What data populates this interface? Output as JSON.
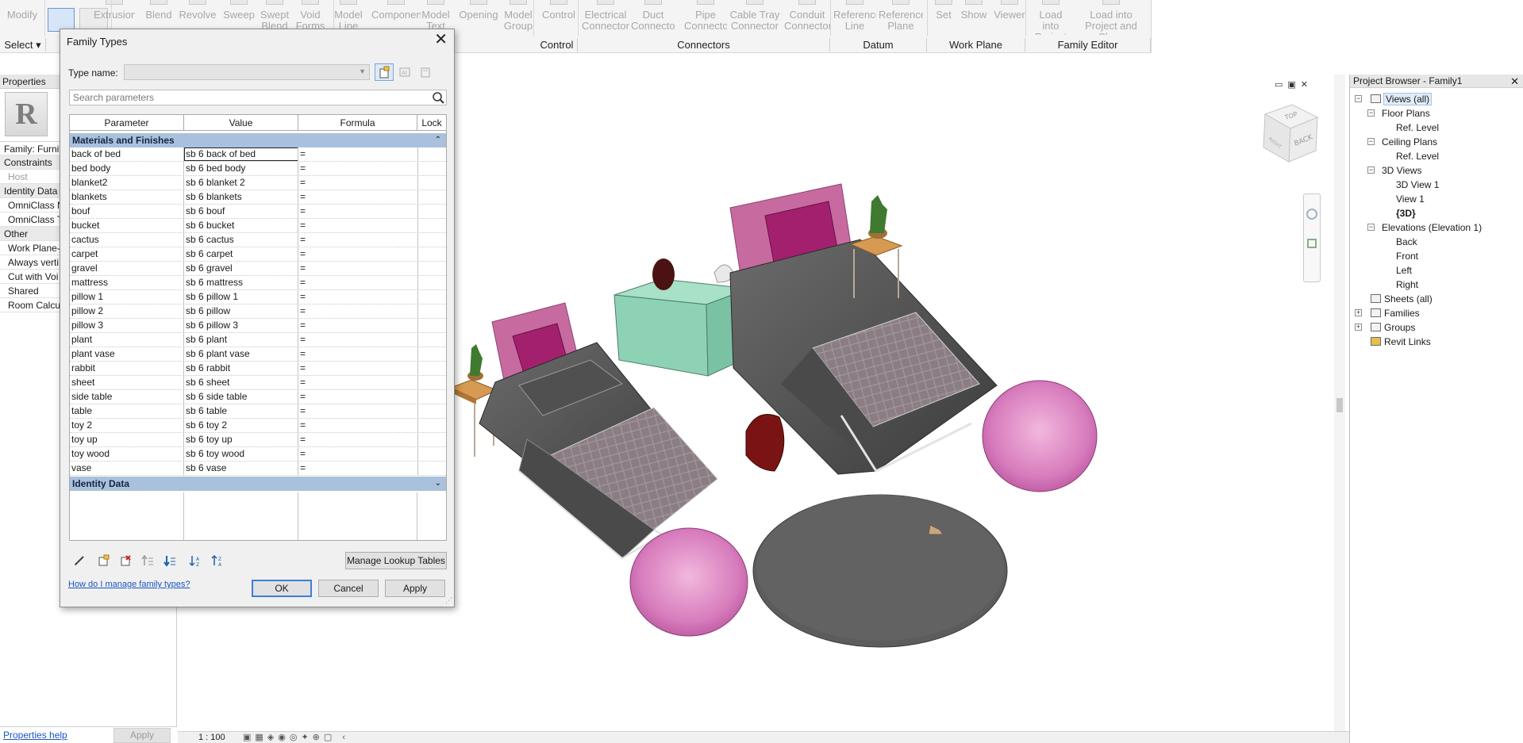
{
  "ribbon": {
    "modify_label": "Modify",
    "select_label": "Select",
    "tools": [
      {
        "label": "Extrusion"
      },
      {
        "label": "Blend"
      },
      {
        "label": "Revolve"
      },
      {
        "label": "Sweep"
      },
      {
        "label": "Swept\nBlend"
      },
      {
        "label": "Void\nForms"
      },
      {
        "label": "Model\nLine"
      },
      {
        "label": "Component"
      },
      {
        "label": "Model\nText"
      },
      {
        "label": "Opening"
      },
      {
        "label": "Model\nGroup"
      },
      {
        "label": "Control"
      },
      {
        "label": "Electrical\nConnector"
      },
      {
        "label": "Duct\nConnector"
      },
      {
        "label": "Pipe\nConnector"
      },
      {
        "label": "Cable Tray\nConnector"
      },
      {
        "label": "Conduit\nConnector"
      },
      {
        "label": "Reference\nLine"
      },
      {
        "label": "Reference\nPlane"
      },
      {
        "label": "Set"
      },
      {
        "label": "Show"
      },
      {
        "label": "Viewer"
      },
      {
        "label": "Load into\nProject"
      },
      {
        "label": "Load into\nProject and Close"
      }
    ],
    "panels": [
      "Control",
      "Connectors",
      "Datum",
      "Work Plane",
      "Family Editor"
    ]
  },
  "properties": {
    "title": "Properties",
    "family_label": "Family: Furnit",
    "rows": [
      {
        "text": "Constraints",
        "kind": "hdr"
      },
      {
        "text": "Host",
        "kind": "dim"
      },
      {
        "text": "Identity Data",
        "kind": "hdr"
      },
      {
        "text": "OmniClass N",
        "kind": "ind"
      },
      {
        "text": "OmniClass T",
        "kind": "ind"
      },
      {
        "text": "Other",
        "kind": "hdr"
      },
      {
        "text": "Work Plane-",
        "kind": "ind"
      },
      {
        "text": "Always verti",
        "kind": "ind"
      },
      {
        "text": "Cut with Voi",
        "kind": "ind"
      },
      {
        "text": "Shared",
        "kind": "ind"
      },
      {
        "text": "Room Calcu",
        "kind": "ind"
      }
    ],
    "help_link": "Properties help",
    "apply_label": "Apply"
  },
  "view": {
    "scale": "1 : 100",
    "viewcube_top": "TOP",
    "viewcube_back": "BACK",
    "viewcube_right": "RIGHT"
  },
  "browser": {
    "title": "Project Browser - Family1",
    "close": "✕",
    "nodes": [
      {
        "label": "Views (all)",
        "level": 0,
        "toggle": "−",
        "selected": true
      },
      {
        "label": "Floor Plans",
        "level": 1,
        "toggle": "−"
      },
      {
        "label": "Ref. Level",
        "level": 2
      },
      {
        "label": "Ceiling Plans",
        "level": 1,
        "toggle": "−"
      },
      {
        "label": "Ref. Level",
        "level": 2
      },
      {
        "label": "3D Views",
        "level": 1,
        "toggle": "−"
      },
      {
        "label": "3D View 1",
        "level": 2
      },
      {
        "label": "View 1",
        "level": 2
      },
      {
        "label": "{3D}",
        "level": 2,
        "bold": true
      },
      {
        "label": "Elevations (Elevation 1)",
        "level": 1,
        "toggle": "−"
      },
      {
        "label": "Back",
        "level": 2
      },
      {
        "label": "Front",
        "level": 2
      },
      {
        "label": "Left",
        "level": 2
      },
      {
        "label": "Right",
        "level": 2
      },
      {
        "label": "Sheets (all)",
        "level": 0
      },
      {
        "label": "Families",
        "level": 0,
        "toggle": "+"
      },
      {
        "label": "Groups",
        "level": 0,
        "toggle": "+"
      },
      {
        "label": "Revit Links",
        "level": 0
      }
    ]
  },
  "dialog": {
    "title": "Family Types",
    "close": "✕",
    "type_name_label": "Type name:",
    "type_name_value": "",
    "search_placeholder": "Search parameters",
    "columns": [
      "Parameter",
      "Value",
      "Formula",
      "Lock"
    ],
    "sections": [
      {
        "name": "Materials and Finishes",
        "collapsed": false
      },
      {
        "name": "Identity Data",
        "collapsed": true
      }
    ],
    "rows": [
      {
        "parameter": "back of bed",
        "value": "sb 6 back of bed",
        "formula": "="
      },
      {
        "parameter": "bed body",
        "value": "sb 6 bed body",
        "formula": "="
      },
      {
        "parameter": "blanket2",
        "value": "sb 6 blanket 2",
        "formula": "="
      },
      {
        "parameter": "blankets",
        "value": "sb 6 blankets",
        "formula": "="
      },
      {
        "parameter": "bouf",
        "value": "sb 6 bouf",
        "formula": "="
      },
      {
        "parameter": "bucket",
        "value": "sb 6 bucket",
        "formula": "="
      },
      {
        "parameter": "cactus",
        "value": "sb 6 cactus",
        "formula": "="
      },
      {
        "parameter": "carpet",
        "value": "sb 6 carpet",
        "formula": "="
      },
      {
        "parameter": "gravel",
        "value": "sb 6 gravel",
        "formula": "="
      },
      {
        "parameter": "mattress",
        "value": "sb 6 mattress",
        "formula": "="
      },
      {
        "parameter": "pillow 1",
        "value": "sb 6 pillow 1",
        "formula": "="
      },
      {
        "parameter": "pillow 2",
        "value": "sb 6 pillow",
        "formula": "="
      },
      {
        "parameter": "pillow 3",
        "value": "sb 6 pillow 3",
        "formula": "="
      },
      {
        "parameter": "plant",
        "value": "sb 6 plant",
        "formula": "="
      },
      {
        "parameter": "plant vase",
        "value": "sb 6 plant vase",
        "formula": "="
      },
      {
        "parameter": "rabbit",
        "value": "sb 6 rabbit",
        "formula": "="
      },
      {
        "parameter": "sheet",
        "value": "sb 6 sheet",
        "formula": "="
      },
      {
        "parameter": "side table",
        "value": "sb 6 side table",
        "formula": "="
      },
      {
        "parameter": "table",
        "value": "sb 6 table",
        "formula": "="
      },
      {
        "parameter": "toy 2",
        "value": "sb 6 toy 2",
        "formula": "="
      },
      {
        "parameter": "toy up",
        "value": "sb 6 toy up",
        "formula": "="
      },
      {
        "parameter": "toy wood",
        "value": "sb 6 toy wood",
        "formula": "="
      },
      {
        "parameter": "vase",
        "value": "sb 6 vase",
        "formula": "="
      }
    ],
    "manage_lookup_label": "Manage Lookup Tables",
    "help_link": "How do I manage family types?",
    "ok_label": "OK",
    "cancel_label": "Cancel",
    "apply_label": "Apply"
  },
  "colors": {
    "section_header": "#a9c1dc",
    "link": "#1a56c4",
    "accent": "#3c7fd8"
  }
}
